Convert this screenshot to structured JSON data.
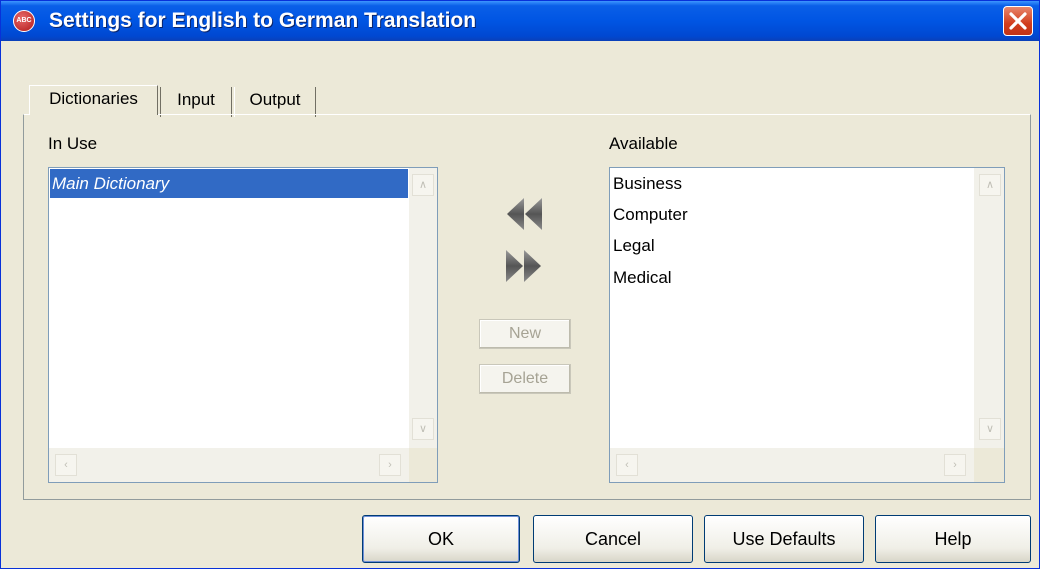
{
  "window": {
    "title": "Settings for English to German Translation",
    "icon_text": "ABC"
  },
  "tabs": [
    {
      "label": "Dictionaries",
      "active": true
    },
    {
      "label": "Input",
      "active": false
    },
    {
      "label": "Output",
      "active": false
    }
  ],
  "in_use": {
    "label": "In Use",
    "items": [
      "Main Dictionary"
    ],
    "selected": "Main Dictionary"
  },
  "available": {
    "label": "Available",
    "items": [
      "Business",
      "Computer",
      "Legal",
      "Medical"
    ]
  },
  "middle": {
    "move_left_icon": "double-arrow-left-icon",
    "move_right_icon": "double-arrow-right-icon",
    "new_label": "New",
    "delete_label": "Delete"
  },
  "buttons": {
    "ok": "OK",
    "cancel": "Cancel",
    "use_defaults": "Use Defaults",
    "help": "Help"
  },
  "colors": {
    "titlebar": "#0055e3",
    "selection": "#316ac5",
    "dialog_bg": "#ece9d8",
    "close": "#d13d1d"
  }
}
